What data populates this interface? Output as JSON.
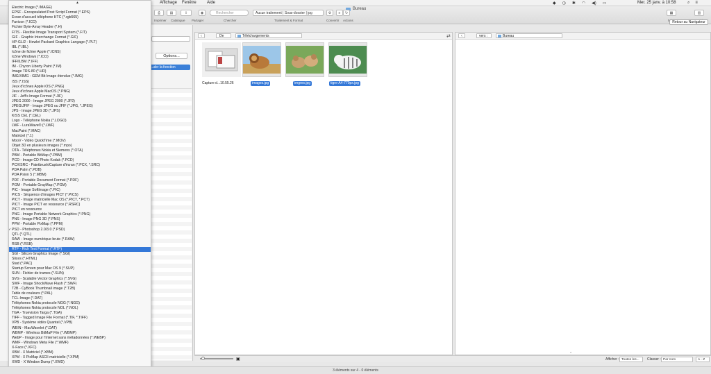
{
  "menubar": {
    "items": [
      "Affichage",
      "Fenêtre",
      "Aide"
    ],
    "clock": "Mer. 25 janv. à 10:58",
    "icons": [
      "wifi-icon",
      "volume-icon",
      "battery-icon"
    ]
  },
  "toolbar": {
    "window_title": "Bureau",
    "buttons": [
      "Imprimer",
      "Catalogue",
      "Partager",
      "Chercher",
      "Traitement & Format",
      "Convertir",
      "Actions",
      "Mise en page",
      "Composition"
    ],
    "search_placeholder": "Rechercher",
    "treatment_value": "Aucun traitement | Sous-dossier | jpg",
    "back_to_browser": "Retour au Navigateur"
  },
  "left_panel": {
    "options_label": "Options...",
    "apply_label": "...uler la fonction"
  },
  "format_menu": {
    "items": [
      "Electric Image (*.IMAGE)",
      "EPSF - Encapsulated Post Script Format (*.EPS)",
      "Écran d'accueil téléphone HTC (*.rgb565)",
      "Favicon (*.ICO)",
      "Fichier Byte-Array Header (*.H)",
      "FITS - Flexible Image Transport System (*.FIT)",
      "GIF - Graphic Interchange Format (*.GIF)",
      "HP-GL/2 - Hewlet Packard Graphics Langage (*.PLT)",
      "IBL (*.IBL)",
      "Icône de fichier Apple (*.ICNS)",
      "Icône Windows (*.ICO)",
      "IFF/ILBM (*.IFF)",
      "IM - Chyron Liberty Paint (*.IM)",
      "Image TRS-80 (*.HR)",
      "IMG/XIMG - GEM Bit Image étendue (*.IMG)",
      "ISS (*.ISS)",
      "Jeux d'icônes Apple iOS (*.PNG)",
      "Jeux d'icônes Apple MacOS (*.PNG)",
      "JIF - Jeff's Image Format (*.JIF)",
      "JPEG 2000 - Image JPEG 2000 (*.JP2)",
      "JPEG/JFIF - Image JPEG ou JFIF (*.JPG, *.JPEG)",
      "JPS - Image JPEG 3D (*.JPS)",
      "KISS CEL (*.CEL)",
      "Logo - Téléphone Nokia (*.LOGO)",
      "LWF - LuraWave® (*.LWF)",
      "MacPaint (*.MAC)",
      "Matriciel (*.1)",
      "MooV - Vidéo QuickTime (*.MOV)",
      "Objet 3D en plusieurs images (*.mpo)",
      "OTA - Téléphones Nokia et Siemens (*.OTA)",
      "PBM - Portable BitMap (*.PBM)",
      "PCD - Image CD Photo Kodak (*.PCD)",
      "PCX/SRC - Paintbrush/Capture d'écran (*.PCX, *.SRC)",
      "PDA Palm (*.PDB)",
      "PDA Psion 5 (*.MBM)",
      "PDF - Portable Document Format (*.PDF)",
      "PGM - Portable GrayMap (*.PGM)",
      "PIC - Image SoftImage (*.PIC)",
      "PICS - Séquence d'images PICT (*.PICS)",
      "PICT - Image matricielle Mac OS (*.PICT, *.PCT)",
      "PICT - Image PICT en ressource (*.RSRC)",
      "PICT en ressource",
      "PNG - Image Portable Network Graphics (*.PNG)",
      "PNS - Image PNG 3D (*.PNS)",
      "PPM - Portable PixMap (*.PPM)",
      "PSD - Photoshop 2.0/3.0 (*.PSD)",
      "QTL (*.QTL)",
      "RAW - Image numérique brute (*.RAW)",
      "RSB (*.RSB)",
      "RTF - Rich Text Format (*.RTF)",
      "SGI - Silicon Graphics Image (*.SGI)",
      "Slices (*.HTML)",
      "Stad (*.PAC)",
      "Startup Screen pour Mac OS 9 (*.SUP)",
      "SUN - Fichier de trames (*.SUN)",
      "SVG - Scalable Vector Graphics (*.SVG)",
      "SWF - Image ShockWave Flash (*.SWF)",
      "T2B - CyBook Thumbnail image (*.T2B)",
      "Table de couleurs (*.PAL)",
      "TCL-Image (*.DAT)",
      "Téléphones Nokia protocole NGG (*.NGG)",
      "Téléphones Nokia protocole NOL (*.NOL)",
      "TGA - Truevision Targa (*.TGA)",
      "TIFF - Tagged Image File Format (*.TIF, *.TIFF)",
      "VPB - Système vidéo Quantel (*.VPB)",
      "WBIN - MacWavelet (*.DAT)",
      "WBMP - Wireless BitMaP File (*.WBMP)",
      "WebP - Image pour l'Internet sans métadonnées (*.WEBP)",
      "WMF - Windows Meta File (*.WMF)",
      "X-Face (*.XFC)",
      "XBM - X Matriciel (*.XBM)",
      "XPM - X PixMap ASCII matricielle (*.XPM)",
      "XWD - X Window Dump (*.XWD)"
    ],
    "checked_index": 45,
    "selected_index": 49,
    "selected_color": "#3478d8"
  },
  "browser_left": {
    "from_label": "De",
    "path": "Téléchargements",
    "files": [
      {
        "name": "Capture d...10.55.26",
        "selected": false,
        "kind": "screenshot"
      },
      {
        "name": "images.jpg",
        "selected": true,
        "kind": "lion"
      },
      {
        "name": "imgres.jpg",
        "selected": true,
        "kind": "cubs"
      },
      {
        "name": "tigre-A4-770px.jpg",
        "selected": true,
        "kind": "tiger"
      }
    ]
  },
  "browser_right": {
    "to_label": "vers :",
    "path": "Bureau"
  },
  "bottombar": {
    "display_label": "Afficher :",
    "display_value": "Toutes les...",
    "sort_label": "Classer :",
    "sort_value": "Par nom",
    "order_value": "A - Z"
  },
  "status": {
    "text": "3 éléments sur 4 - 0 éléments"
  }
}
